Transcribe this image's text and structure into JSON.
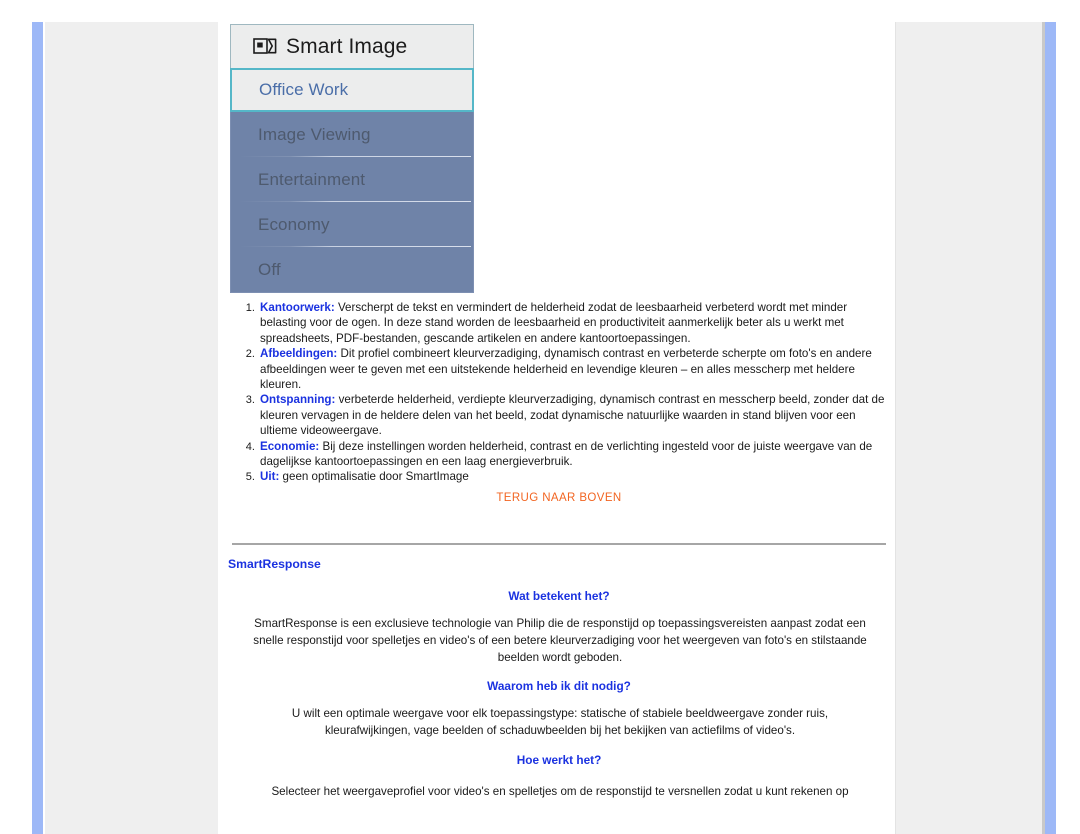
{
  "page": {
    "accent_rail_color": "#9db8f7",
    "background_color": "#efefef",
    "content_background": "#ffffff"
  },
  "smart_image_panel": {
    "icon": "smart-image-icon",
    "title": "Smart Image",
    "selected_item": "Office Work",
    "selected_border_color": "#55b7c8",
    "list_background": "#6f83a8",
    "items": [
      {
        "label": "Image Viewing"
      },
      {
        "label": "Entertainment"
      },
      {
        "label": "Economy"
      },
      {
        "label": "Off"
      }
    ]
  },
  "description_list": [
    {
      "term": "Kantoorwerk:",
      "text": " Verscherpt de tekst en vermindert de helderheid zodat de leesbaarheid verbeterd wordt met minder belasting voor de ogen. In deze stand worden de leesbaarheid en productiviteit aanmerkelijk beter als u werkt met spreadsheets, PDF-bestanden, gescande artikelen en andere kantoortoepassingen."
    },
    {
      "term": "Afbeeldingen:",
      "text": " Dit profiel combineert kleurverzadiging, dynamisch contrast en verbeterde scherpte om foto's en andere afbeeldingen weer te geven met een uitstekende helderheid en levendige kleuren – en alles messcherp met heldere kleuren."
    },
    {
      "term": "Ontspanning:",
      "text": " verbeterde helderheid, verdiepte kleurverzadiging, dynamisch contrast en messcherp beeld, zonder dat de kleuren vervagen in de heldere delen van het beeld, zodat dynamische natuurlijke waarden in stand blijven voor een ultieme videoweergave."
    },
    {
      "term": "Economie:",
      "text": " Bij deze instellingen worden helderheid, contrast en de verlichting ingesteld voor de juiste weergave van de dagelijkse kantoortoepassingen en een laag energieverbruik."
    },
    {
      "term": "Uit:",
      "text": " geen optimalisatie door SmartImage"
    }
  ],
  "back_to_top": {
    "label": "TERUG NAAR BOVEN",
    "color": "#f26522"
  },
  "smart_response": {
    "section_title": "SmartResponse",
    "blocks": [
      {
        "heading": "Wat betekent het?",
        "paragraph": "SmartResponse is een exclusieve technologie van Philip die de responstijd op toepassingsvereisten aanpast zodat een snelle responstijd voor spelletjes en video's of een betere kleurverzadiging voor het weergeven van foto's en stilstaande beelden wordt geboden."
      },
      {
        "heading": "Waarom heb ik dit nodig?",
        "paragraph": "U wilt een optimale weergave voor elk toepassingstype: statische of stabiele beeldweergave zonder ruis, kleurafwijkingen, vage beelden of schaduwbeelden bij het bekijken van actiefilms of video's."
      },
      {
        "heading": "Hoe werkt het?",
        "paragraph": "Selecteer het weergaveprofiel voor video's en spelletjes om de responstijd te versnellen zodat u kunt rekenen op"
      }
    ]
  }
}
